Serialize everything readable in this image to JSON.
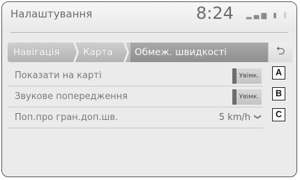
{
  "header": {
    "title": "Налаштування",
    "clock": "8:24",
    "status_icons": [
      "signal-icon",
      "battery-icon",
      "bluetooth-icon"
    ]
  },
  "breadcrumb": {
    "items": [
      "Навігація",
      "Карта",
      "Обмеж. швидкості"
    ],
    "back_icon": "back-arrow-icon"
  },
  "settings": [
    {
      "label": "Показати на карті",
      "control": "Увімк.",
      "callout": "A"
    },
    {
      "label": "Звукове попередження",
      "control": "Увімк.",
      "callout": "B"
    },
    {
      "label": "Поп.про гран.доп.шв.",
      "control": "5 km/h",
      "callout": "C"
    }
  ],
  "colors": {
    "accent": "#8f8f8f",
    "background": "#ebebeb"
  }
}
